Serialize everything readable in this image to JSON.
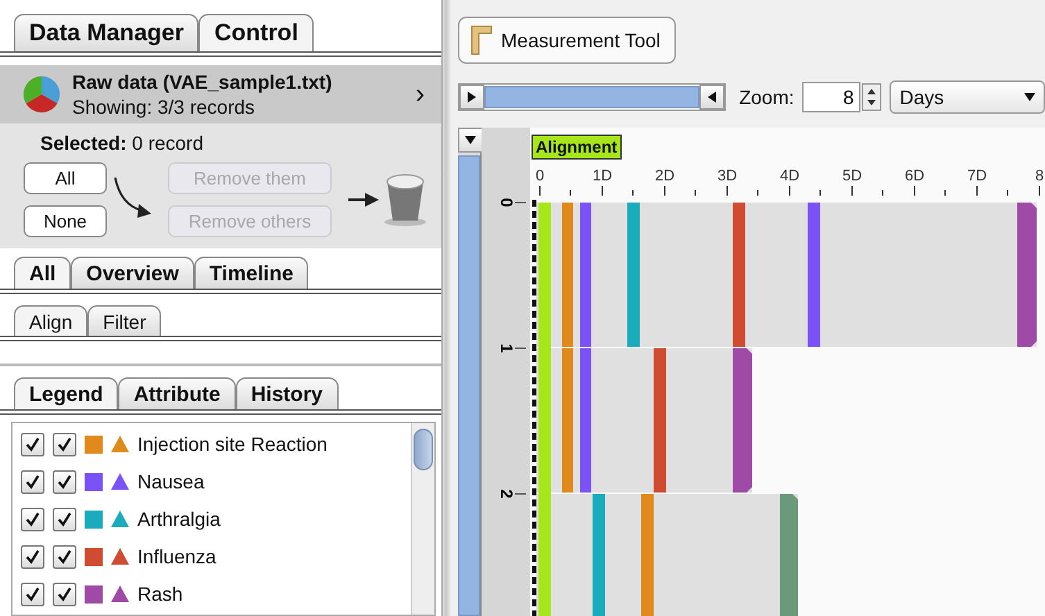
{
  "left_tabs": [
    {
      "label": "Data Manager",
      "selected": false
    },
    {
      "label": "Control",
      "selected": true
    }
  ],
  "dataset": {
    "title": "Raw data (VAE_sample1.txt)",
    "subtitle": "Showing: 3/3 records",
    "chevron": "›"
  },
  "selection": {
    "label": "**Selected:** 0 record",
    "pick_buttons": [
      {
        "label": "All",
        "disabled": false
      },
      {
        "label": "None",
        "disabled": false
      }
    ],
    "remove_buttons": [
      {
        "label": "Remove them",
        "disabled": true
      },
      {
        "label": "Remove others",
        "disabled": true
      }
    ]
  },
  "view_tabs": [
    {
      "label": "All",
      "selected": true
    },
    {
      "label": "Overview",
      "selected": false
    },
    {
      "label": "Timeline",
      "selected": false
    }
  ],
  "sub_tabs": [
    {
      "label": "Align",
      "selected": true
    },
    {
      "label": "Filter",
      "selected": false
    }
  ],
  "panel_tabs": [
    {
      "label": "Legend",
      "selected": true
    },
    {
      "label": "Attribute",
      "selected": false
    },
    {
      "label": "History",
      "selected": false
    }
  ],
  "legend": [
    {
      "label": "Injection site Reaction",
      "color": "#e08a1e",
      "checkbox_1_checked": true,
      "checkbox_2_checked": true
    },
    {
      "label": "Nausea",
      "color": "#7b52f5",
      "checkbox_1_checked": true,
      "checkbox_2_checked": true
    },
    {
      "label": "Arthralgia",
      "color": "#1aabbd",
      "checkbox_1_checked": true,
      "checkbox_2_checked": true
    },
    {
      "label": "Influenza",
      "color": "#cf4b31",
      "checkbox_1_checked": true,
      "checkbox_2_checked": true
    },
    {
      "label": "Rash",
      "color": "#a04aa8",
      "checkbox_1_checked": true,
      "checkbox_2_checked": true
    }
  ],
  "measure_button": "Measurement Tool",
  "zoom": {
    "label": "Zoom:",
    "value": "8"
  },
  "unit_dropdown": {
    "value": "Days"
  },
  "timeline": {
    "alignment_label": "Alignment",
    "axis_ticks": [
      "0",
      "1D",
      "2D",
      "3D",
      "4D",
      "5D",
      "6D",
      "7D",
      "8"
    ],
    "record_labels": [
      "0",
      "1",
      "2"
    ]
  }
}
